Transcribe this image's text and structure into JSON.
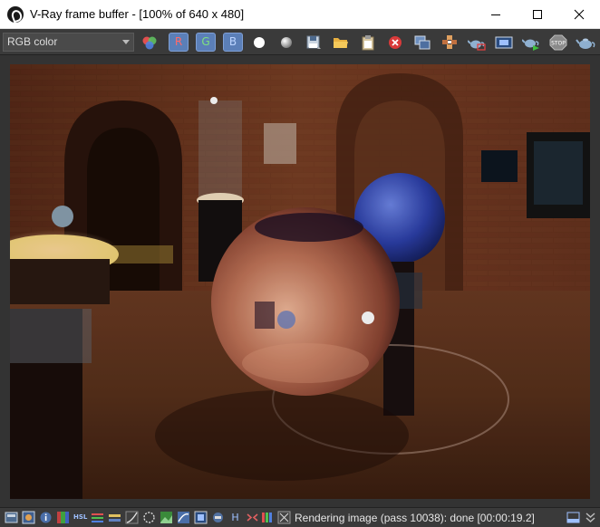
{
  "window": {
    "title": "V-Ray frame buffer - [100% of 640 x 480]"
  },
  "toolbar": {
    "channel": "RGB color",
    "red_label": "R",
    "green_label": "G",
    "blue_label": "B",
    "stop_label": "STOP"
  },
  "statusbar": {
    "hsl_label": "HSL",
    "h_label": "H",
    "status": "Rendering image (pass 10038): done [00:00:19.2]"
  },
  "colors": {
    "toolbar_bg": "#3a3a3a",
    "rgb_button": "#5b7fb8",
    "red": "#e05050",
    "green": "#60c060",
    "blue": "#5080e0"
  }
}
